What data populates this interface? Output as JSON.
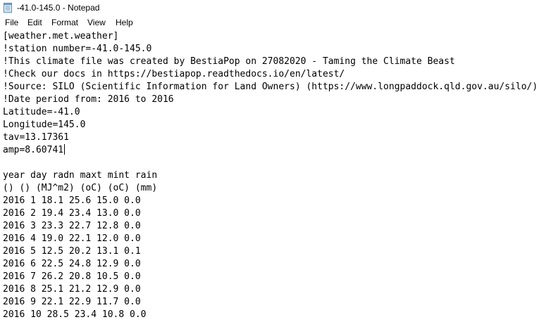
{
  "window": {
    "title": "-41.0-145.0 - Notepad",
    "icon": "notepad-icon"
  },
  "menu": {
    "items": [
      "File",
      "Edit",
      "Format",
      "View",
      "Help"
    ]
  },
  "editor": {
    "lines": [
      "[weather.met.weather]",
      "!station number=-41.0-145.0",
      "!This climate file was created by BestiaPop on 27082020 - Taming the Climate Beast",
      "!Check our docs in https://bestiapop.readthedocs.io/en/latest/",
      "!Source: SILO (Scientific Information for Land Owners) (https://www.longpaddock.qld.gov.au/silo/)",
      "!Date period from: 2016 to 2016",
      "Latitude=-41.0",
      "Longitude=145.0",
      "tav=13.17361",
      "amp=8.60741",
      "",
      "year day radn maxt mint rain",
      "() () (MJ^m2) (oC) (oC) (mm)",
      "2016 1 18.1 25.6 15.0 0.0",
      "2016 2 19.4 23.4 13.0 0.0",
      "2016 3 23.3 22.7 12.8 0.0",
      "2016 4 19.0 22.1 12.0 0.0",
      "2016 5 12.5 20.2 13.1 0.1",
      "2016 6 22.5 24.8 12.9 0.0",
      "2016 7 26.2 20.8 10.5 0.0",
      "2016 8 25.1 21.2 12.9 0.0",
      "2016 9 22.1 22.9 11.7 0.0",
      "2016 10 28.5 23.4 10.8 0.0"
    ]
  }
}
